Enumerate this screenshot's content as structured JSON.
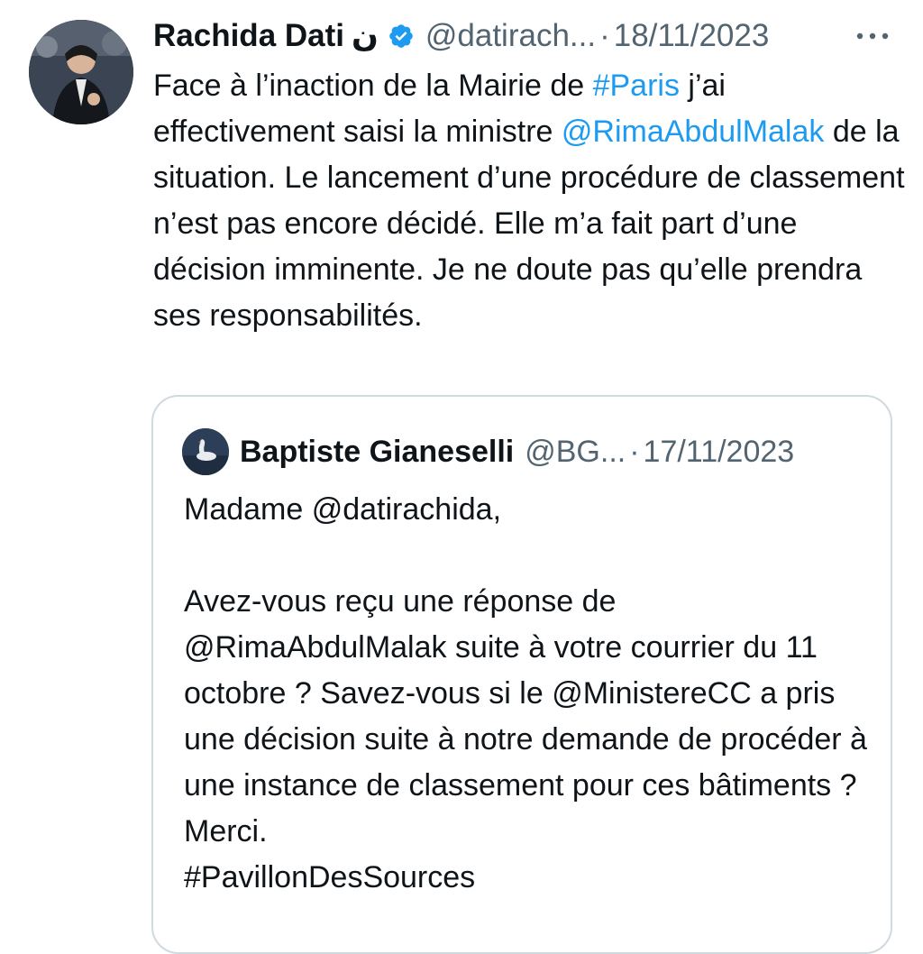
{
  "tweet": {
    "author": {
      "name": "Rachida Dati",
      "name_suffix": "ن",
      "handle": "@datirach...",
      "verified_icon": "verified-badge-icon"
    },
    "separator": "·",
    "date": "18/11/2023",
    "more_label": "•••",
    "body": {
      "p1": "Face à l’inaction de la Mairie de ",
      "hashtag_paris": "#Paris",
      "p2": " j’ai effectivement saisi la ministre ",
      "mention_rima": "@RimaAbdulMalak",
      "p3": " de la situation. Le lancement d’une procédure de classement n’est pas encore décidé. Elle m’a fait part d’une décision imminente. Je ne doute pas qu’elle prendra ses responsabilités."
    }
  },
  "quoted_tweet": {
    "author": {
      "name": "Baptiste Gianeselli",
      "handle": "@BG..."
    },
    "separator": "·",
    "date": "17/11/2023",
    "body": {
      "line1": "Madame @datirachida,",
      "paragraph2": "Avez-vous reçu une réponse de @RimaAbdulMalak suite à votre courrier du 11 octobre ? Savez-vous si le @MinistereCC a pris une décision suite à notre demande de procéder à une instance de classement pour ces bâtiments ? Merci.",
      "hashtag": "#PavillonDesSources"
    }
  },
  "colors": {
    "text": "#0f1419",
    "muted": "#536471",
    "link": "#1d9bf0",
    "border": "#cfd9de"
  }
}
